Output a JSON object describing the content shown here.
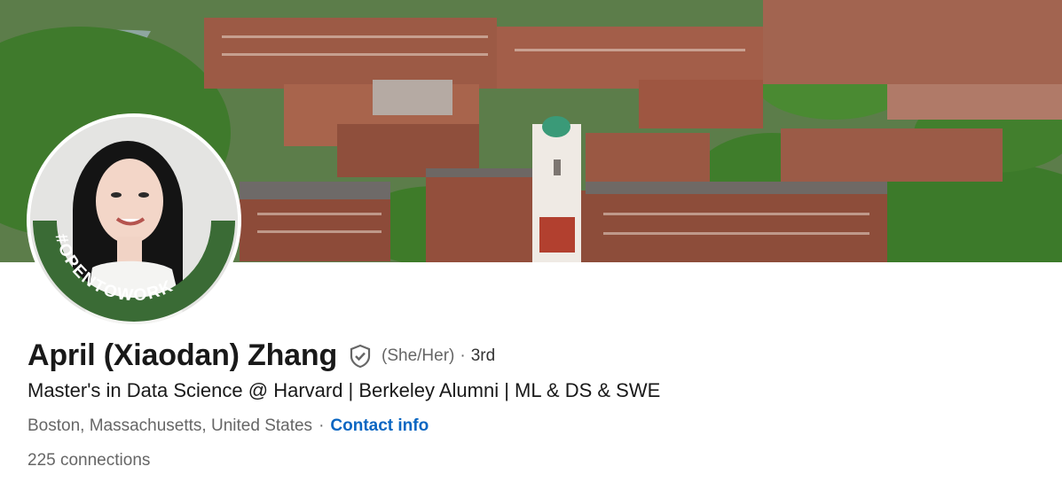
{
  "profile": {
    "name": "April (Xiaodan) Zhang",
    "pronouns": "(She/Her)",
    "separator": "·",
    "degree": "3rd",
    "headline": "Master's in Data Science @ Harvard | Berkeley Alumni | ML & DS & SWE",
    "location": "Boston, Massachusetts, United States",
    "location_separator": "·",
    "contact_label": "Contact info",
    "connections_count": "225",
    "connections_label": "connections"
  },
  "badge": {
    "frame_text": "#OPENTOWORK",
    "frame_color": "#3a6b35"
  },
  "colors": {
    "link": "#0a66c2",
    "muted": "#666666",
    "text": "#191919"
  },
  "icons": {
    "verification": "shield-check-icon"
  }
}
